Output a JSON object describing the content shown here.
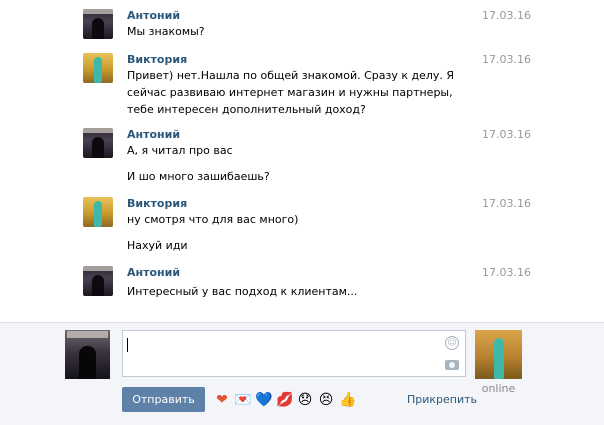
{
  "messages": [
    {
      "author": "Антоний",
      "date": "17.03.16",
      "avatar": "antony",
      "texts": [
        "Мы знакомы?"
      ]
    },
    {
      "author": "Виктория",
      "date": "17.03.16",
      "avatar": "victoria",
      "texts": [
        "Привет) нет.Нашла по общей знакомой. Сразу к делу. Я сейчас развиваю интернет магазин и нужны партнеры, тебе интересен дополнительный доход?"
      ]
    },
    {
      "author": "Антоний",
      "date": "17.03.16",
      "avatar": "antony",
      "texts": [
        "А, я читал про вас",
        "И шо много зашибаешь?"
      ]
    },
    {
      "author": "Виктория",
      "date": "17.03.16",
      "avatar": "victoria",
      "texts": [
        "ну смотря что для вас много)",
        "Нахуй иди"
      ]
    },
    {
      "author": "Антоний",
      "date": "17.03.16",
      "avatar": "antony",
      "texts": [
        "Интересный у вас подход к клиентам..."
      ]
    }
  ],
  "composer": {
    "message_value": "",
    "send_label": "Отправить",
    "attach_label": "Прикрепить",
    "recipient_status": "online",
    "smile_icon": "☺",
    "emojis": [
      "❤",
      "💌",
      "💙",
      "💋",
      "😞",
      "😣",
      "👍"
    ]
  },
  "colors": {
    "author": "#2b587a",
    "date": "#999999",
    "send_button": "#5e81a8",
    "composer_bg": "#f3f5f8"
  }
}
